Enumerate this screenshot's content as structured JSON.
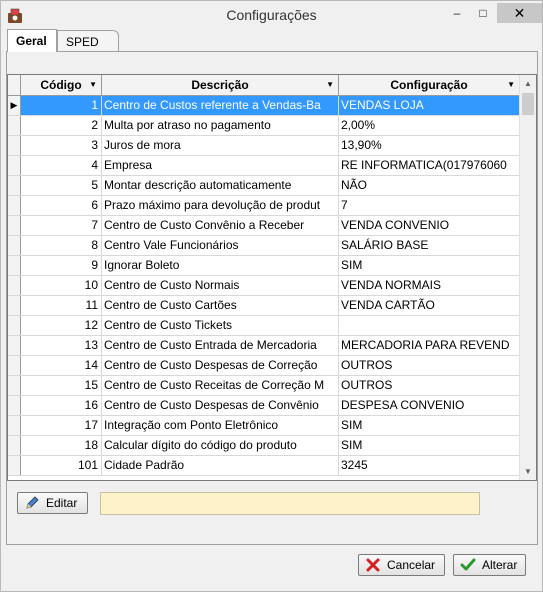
{
  "window": {
    "title": "Configurações"
  },
  "titlebar": {
    "minimize": "–",
    "maximize": "□",
    "close": "✕"
  },
  "tabs": [
    {
      "label": "Geral",
      "active": true
    },
    {
      "label": "SPED",
      "active": false
    }
  ],
  "grid": {
    "columns": {
      "code": "Código",
      "description": "Descrição",
      "config": "Configuração"
    },
    "selected_row_indicator": "▶",
    "rows": [
      {
        "code": "1",
        "description": "Centro de Custos referente a Vendas-Ba",
        "config": "VENDAS LOJA"
      },
      {
        "code": "2",
        "description": "Multa por atraso no pagamento",
        "config": "2,00%"
      },
      {
        "code": "3",
        "description": "Juros de mora",
        "config": "13,90%"
      },
      {
        "code": "4",
        "description": "Empresa",
        "config": "RE INFORMATICA(017976060"
      },
      {
        "code": "5",
        "description": "Montar descrição automaticamente",
        "config": "NÃO"
      },
      {
        "code": "6",
        "description": "Prazo máximo para devolução de produt",
        "config": "7"
      },
      {
        "code": "7",
        "description": "Centro de Custo Convênio a Receber",
        "config": "VENDA CONVENIO"
      },
      {
        "code": "8",
        "description": "Centro Vale Funcionários",
        "config": "SALÁRIO BASE"
      },
      {
        "code": "9",
        "description": "Ignorar Boleto",
        "config": "SIM"
      },
      {
        "code": "10",
        "description": "Centro de Custo Normais",
        "config": "VENDA NORMAIS"
      },
      {
        "code": "11",
        "description": "Centro de Custo Cartões",
        "config": "VENDA CARTÃO"
      },
      {
        "code": "12",
        "description": "Centro de Custo Tickets",
        "config": ""
      },
      {
        "code": "13",
        "description": "Centro de Custo Entrada de Mercadoria",
        "config": "MERCADORIA PARA REVEND"
      },
      {
        "code": "14",
        "description": "Centro de Custo Despesas de Correção",
        "config": "OUTROS"
      },
      {
        "code": "15",
        "description": "Centro de Custo Receitas de Correção M",
        "config": "OUTROS"
      },
      {
        "code": "16",
        "description": "Centro de Custo Despesas de Convênio",
        "config": "DESPESA CONVENIO"
      },
      {
        "code": "17",
        "description": "Integração com Ponto Eletrônico",
        "config": "SIM"
      },
      {
        "code": "18",
        "description": "Calcular dígito do código do produto",
        "config": "SIM"
      },
      {
        "code": "101",
        "description": "Cidade Padrão",
        "config": "3245"
      }
    ]
  },
  "actions": {
    "edit_label": "Editar",
    "edit_value": "",
    "cancel_label": "Cancelar",
    "confirm_label": "Alterar"
  },
  "colors": {
    "selection": "#3399ff",
    "edit_field": "#fdf2c8"
  },
  "icons": {
    "app": "app-icon",
    "edit": "pencil-icon",
    "cancel": "x-icon",
    "confirm": "check-icon"
  }
}
